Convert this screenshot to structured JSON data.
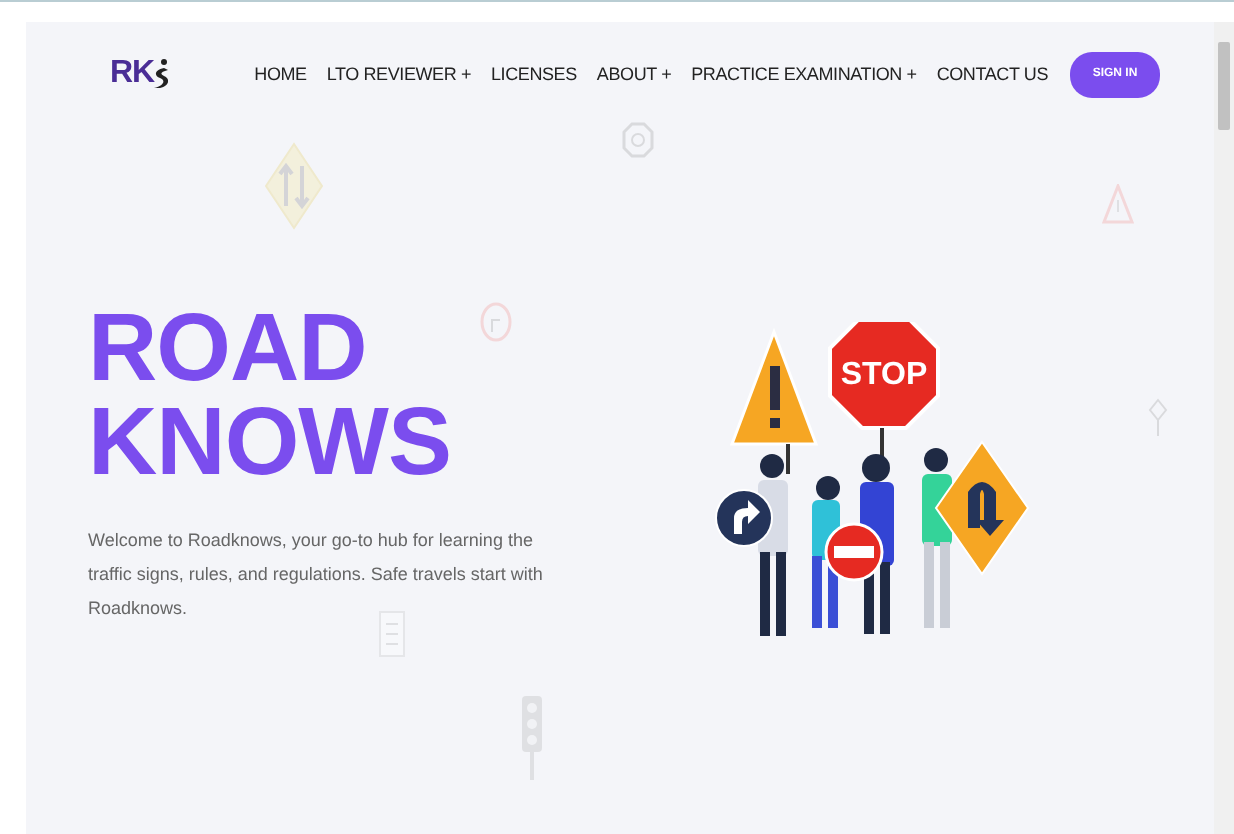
{
  "logo": {
    "text": "RK"
  },
  "nav": {
    "items": [
      {
        "label": "HOME"
      },
      {
        "label": "LTO REVIEWER +"
      },
      {
        "label": "LICENSES"
      },
      {
        "label": "ABOUT +"
      },
      {
        "label": "PRACTICE EXAMINATION +"
      },
      {
        "label": "CONTACT US"
      }
    ],
    "button": "SIGN IN"
  },
  "hero": {
    "title_lines": [
      "ROAD",
      "KNOWS"
    ],
    "text": "Welcome to Roadknows, your go-to hub for learning the traffic signs, rules, and regulations. Safe travels start with Roadknows.",
    "illustration": {
      "stop_sign": "STOP"
    }
  }
}
